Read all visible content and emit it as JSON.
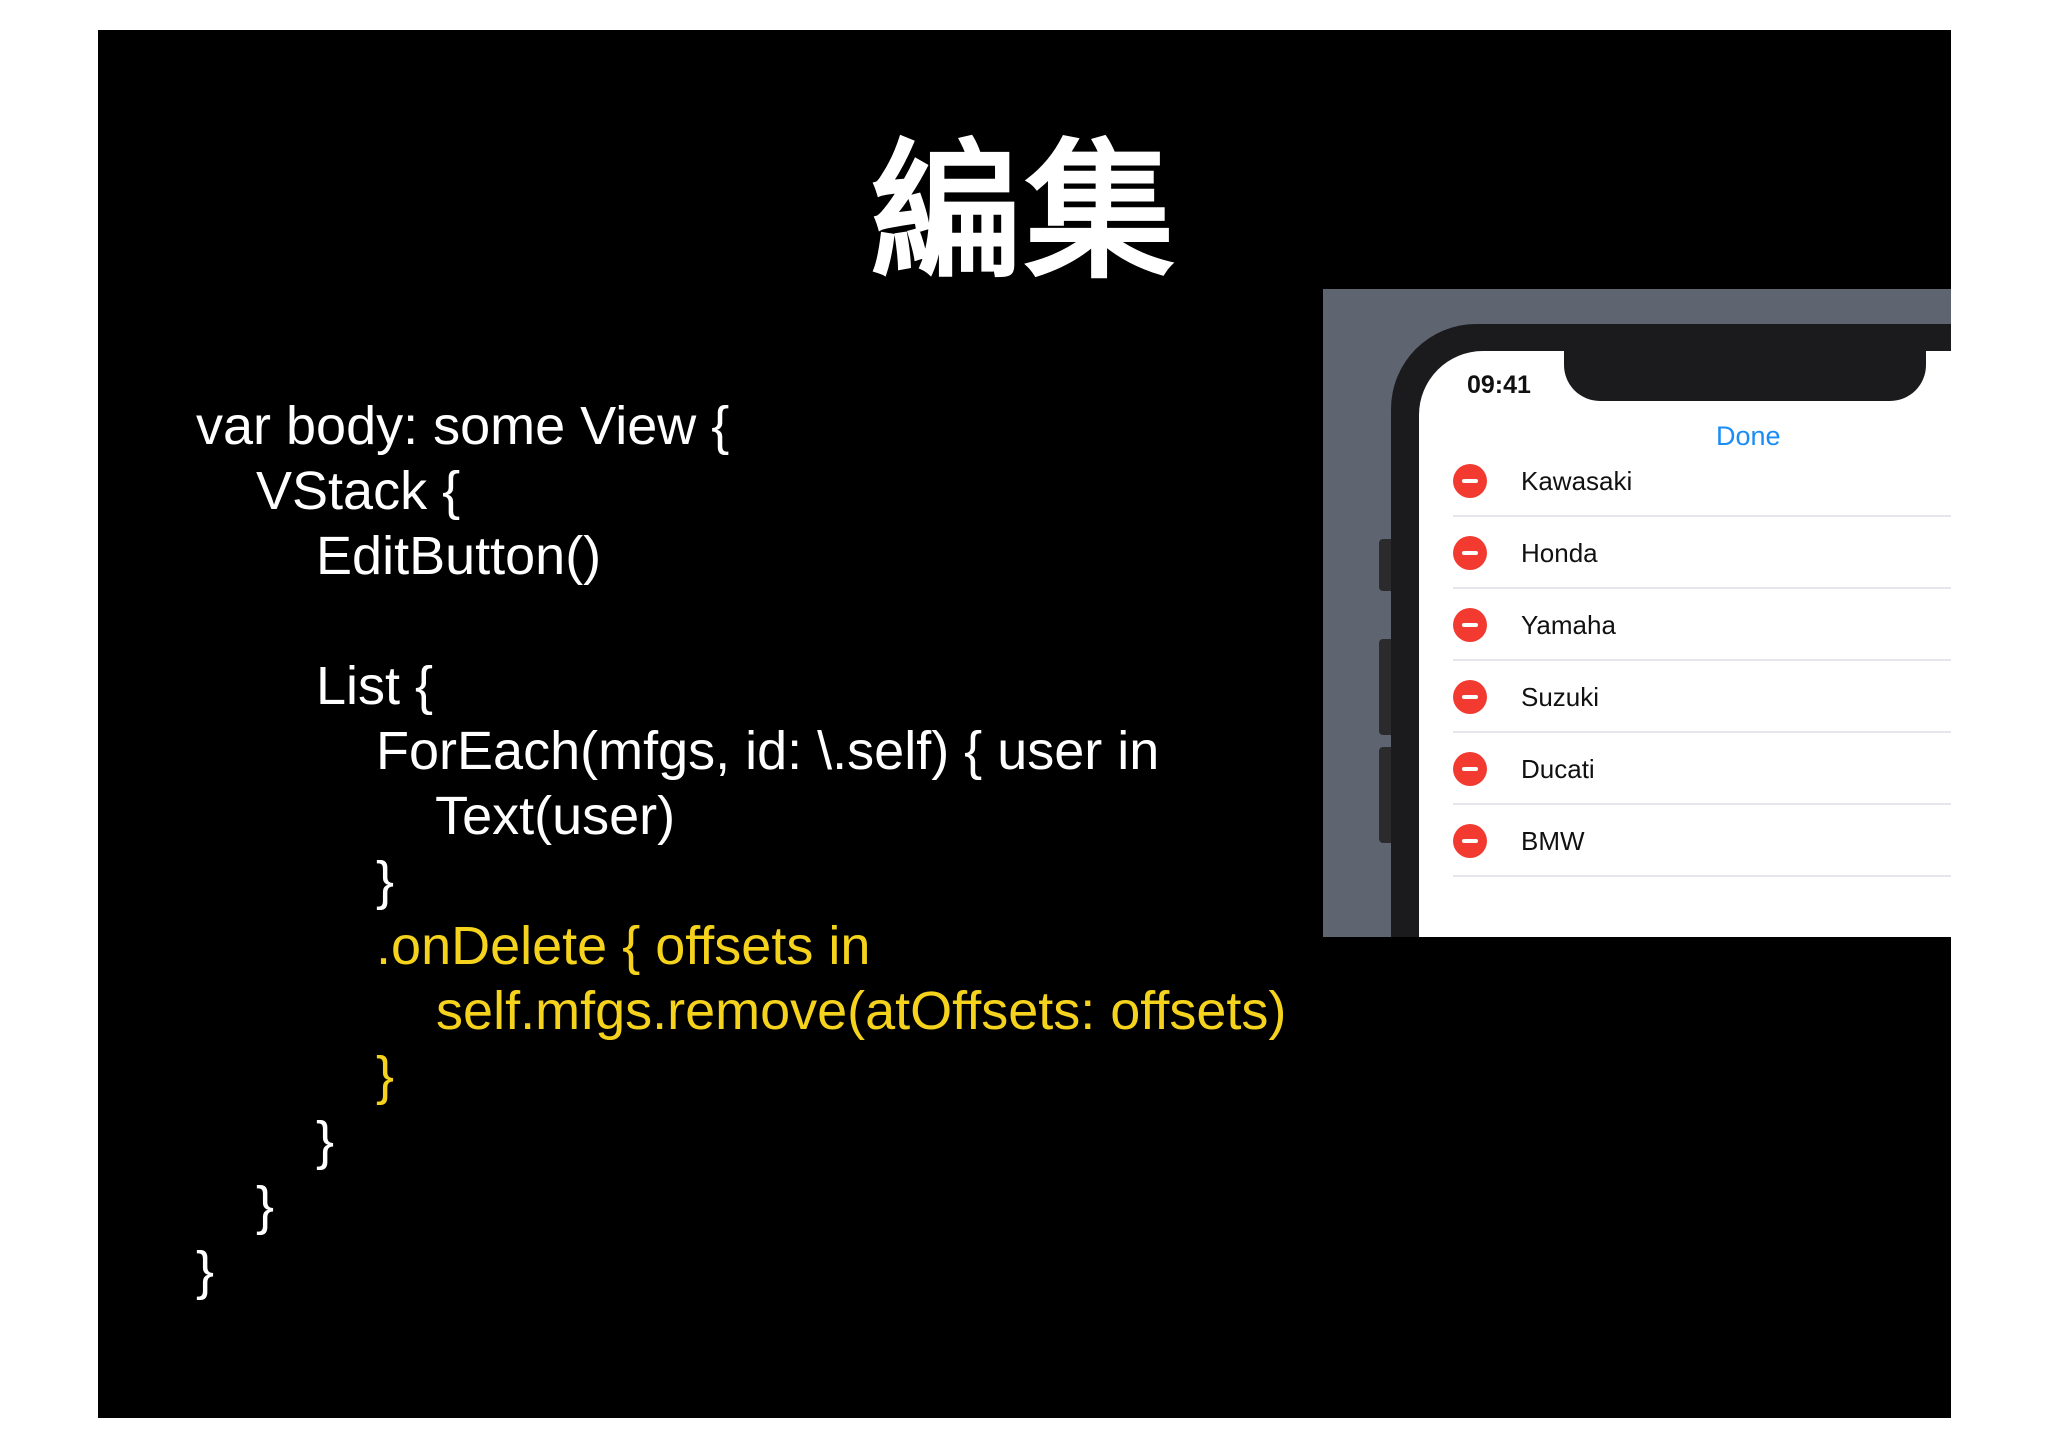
{
  "slide": {
    "title": "編集",
    "code_lines": [
      {
        "text": "var body: some View {",
        "highlight": false
      },
      {
        "text": "    VStack {",
        "highlight": false
      },
      {
        "text": "        EditButton()",
        "highlight": false
      },
      {
        "text": "",
        "highlight": false
      },
      {
        "text": "        List {",
        "highlight": false
      },
      {
        "text": "            ForEach(mfgs, id: \\.self) { user in",
        "highlight": false
      },
      {
        "text": "                Text(user)",
        "highlight": false
      },
      {
        "text": "            }",
        "highlight": false
      },
      {
        "text": "            .onDelete { offsets in",
        "highlight": true
      },
      {
        "text": "                self.mfgs.remove(atOffsets: offsets)",
        "highlight": true
      },
      {
        "text": "            }",
        "highlight": true
      },
      {
        "text": "        }",
        "highlight": false
      },
      {
        "text": "    }",
        "highlight": false
      },
      {
        "text": "}",
        "highlight": false
      }
    ],
    "colors": {
      "background": "#000000",
      "code": "#ffffff",
      "highlight": "#f5d31c"
    }
  },
  "phone": {
    "status_time": "09:41",
    "done_label": "Done",
    "items": [
      {
        "label": "Kawasaki"
      },
      {
        "label": "Honda"
      },
      {
        "label": "Yamaha"
      },
      {
        "label": "Suzuki"
      },
      {
        "label": "Ducati"
      },
      {
        "label": "BMW"
      }
    ],
    "delete_icon": "minus-circle-icon",
    "colors": {
      "accent": "#1a8cf5",
      "delete": "#f23a30"
    }
  }
}
